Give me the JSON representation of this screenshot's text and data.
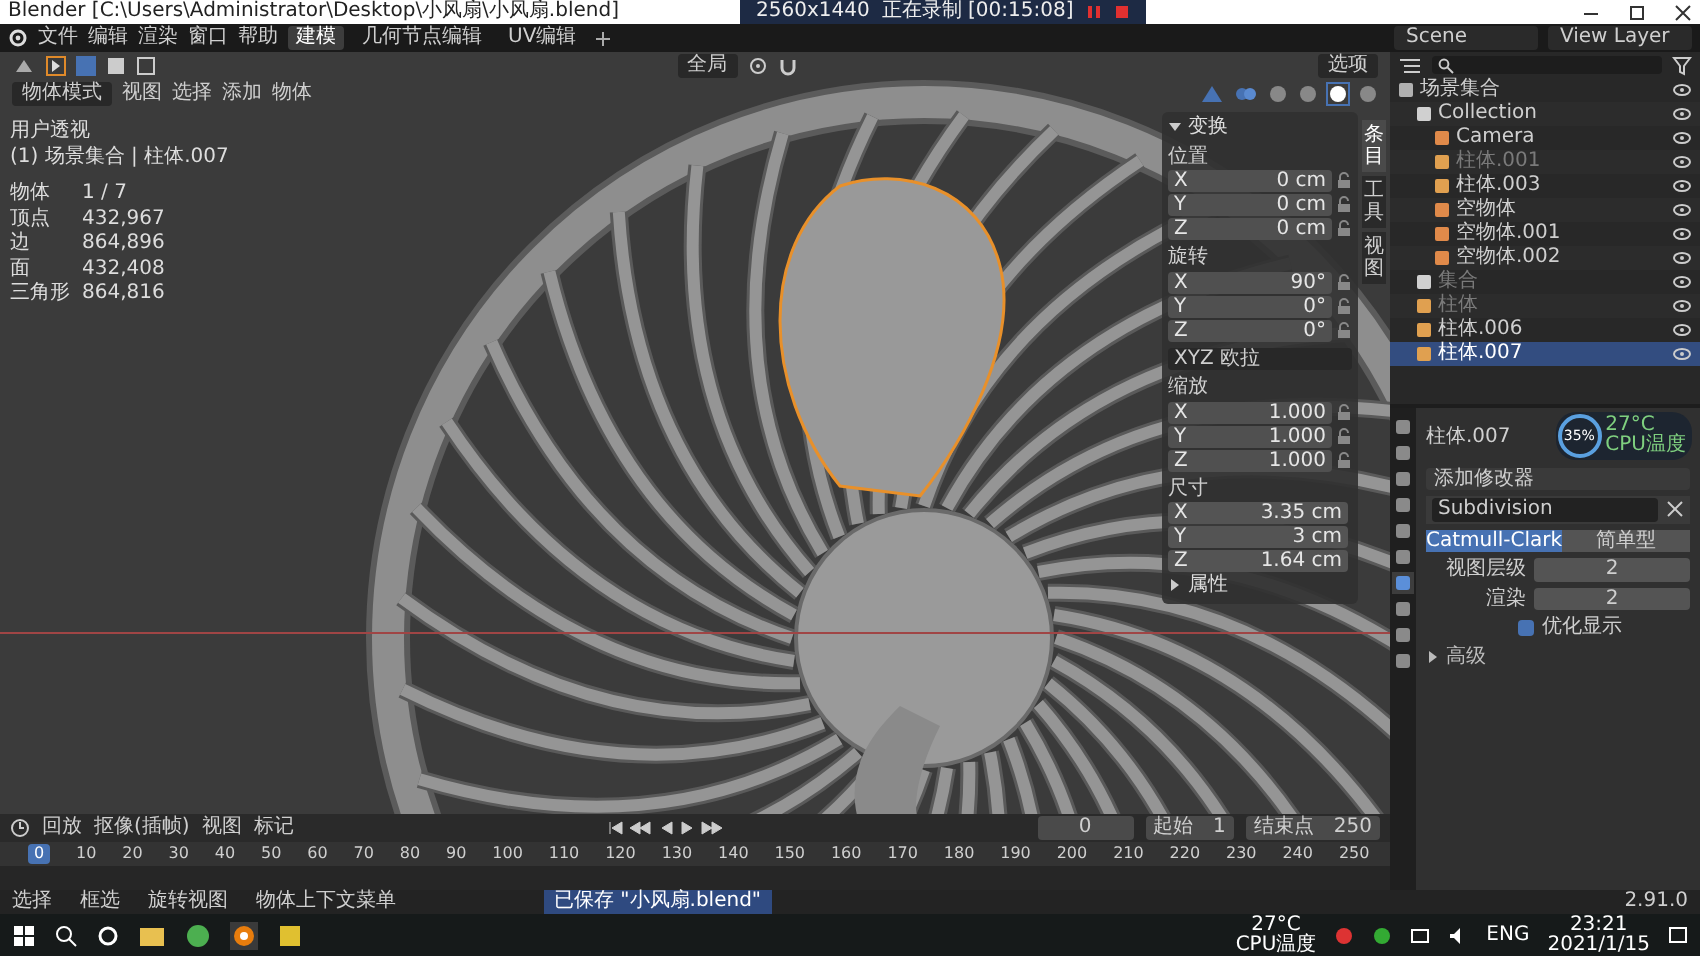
{
  "title_bar": {
    "title": "Blender [C:\\Users\\Administrator\\Desktop\\小风扇\\小风扇.blend]",
    "resolution": "2560x1440",
    "recording": "正在录制 [00:15:08]"
  },
  "menu": [
    "文件",
    "编辑",
    "渲染",
    "窗口",
    "帮助"
  ],
  "workspaces": [
    {
      "label": "建模",
      "selected": true
    },
    {
      "label": "几何节点编辑",
      "selected": false
    },
    {
      "label": "UV编辑",
      "selected": false
    }
  ],
  "scene": "Scene",
  "view_layer": "View Layer",
  "viewport": {
    "orientation": "全局",
    "options": "选项",
    "mode": "物体模式",
    "menus": [
      "视图",
      "选择",
      "添加",
      "物体"
    ],
    "shading": [
      {
        "selected": false
      },
      {
        "selected": false
      },
      {
        "selected": true
      },
      {
        "selected": false
      }
    ],
    "view_name": "用户透视",
    "context": "(1) 场景集合 | 柱体.007",
    "stats": [
      {
        "label": "物体",
        "value": "1 / 7"
      },
      {
        "label": "顶点",
        "value": "432,967"
      },
      {
        "label": "边",
        "value": "864,896"
      },
      {
        "label": "面",
        "value": "432,408"
      },
      {
        "label": "三角形",
        "value": "864,816"
      }
    ]
  },
  "n_panel": {
    "title": "变换",
    "tabs": [
      {
        "label": "条目",
        "selected": true
      },
      {
        "label": "工具",
        "selected": false
      },
      {
        "label": "视图",
        "selected": false
      }
    ],
    "groups": [
      {
        "kind": "fields",
        "label": "位置",
        "lockable": true,
        "fields": [
          {
            "axis": "X",
            "value": "0 cm"
          },
          {
            "axis": "Y",
            "value": "0 cm"
          },
          {
            "axis": "Z",
            "value": "0 cm"
          }
        ]
      },
      {
        "kind": "fields",
        "label": "旋转",
        "lockable": true,
        "fields": [
          {
            "axis": "X",
            "value": "90°"
          },
          {
            "axis": "Y",
            "value": "0°"
          },
          {
            "axis": "Z",
            "value": "0°"
          }
        ]
      },
      {
        "kind": "dropdown",
        "label": "XYZ 欧拉"
      },
      {
        "kind": "fields",
        "label": "缩放",
        "lockable": true,
        "fields": [
          {
            "axis": "X",
            "value": "1.000"
          },
          {
            "axis": "Y",
            "value": "1.000"
          },
          {
            "axis": "Z",
            "value": "1.000"
          }
        ]
      },
      {
        "kind": "fields",
        "label": "尺寸",
        "lockable": false,
        "fields": [
          {
            "axis": "X",
            "value": "3.35 cm"
          },
          {
            "axis": "Y",
            "value": "3 cm"
          },
          {
            "axis": "Z",
            "value": "1.64 cm"
          }
        ]
      }
    ],
    "properties_section": "属性"
  },
  "outliner": {
    "items": [
      {
        "name": "场景集合",
        "kind": "scene",
        "selected": false,
        "greyed": false,
        "children": [
          {
            "name": "Collection",
            "kind": "collection",
            "selected": false,
            "greyed": false,
            "children": [
              {
                "name": "Camera",
                "kind": "camera",
                "selected": false,
                "greyed": false
              },
              {
                "name": "柱体.001",
                "kind": "mesh",
                "selected": false,
                "greyed": true
              },
              {
                "name": "柱体.003",
                "kind": "mesh",
                "selected": false,
                "greyed": false
              },
              {
                "name": "空物体",
                "kind": "empty",
                "selected": false,
                "greyed": false
              },
              {
                "name": "空物体.001",
                "kind": "empty",
                "selected": false,
                "greyed": false
              },
              {
                "name": "空物体.002",
                "kind": "empty",
                "selected": false,
                "greyed": false
              }
            ]
          },
          {
            "name": "集合",
            "kind": "collection",
            "selected": false,
            "greyed": true
          },
          {
            "name": "柱体",
            "kind": "mesh",
            "selected": false,
            "greyed": true
          },
          {
            "name": "柱体.006",
            "kind": "mesh",
            "selected": false,
            "greyed": false
          },
          {
            "name": "柱体.007",
            "kind": "mesh",
            "selected": true,
            "greyed": false
          }
        ]
      }
    ]
  },
  "properties": {
    "tabs": [
      {
        "selected": false
      },
      {
        "selected": false
      },
      {
        "selected": false
      },
      {
        "selected": false
      },
      {
        "selected": false
      },
      {
        "selected": false
      },
      {
        "selected": true
      },
      {
        "selected": false
      },
      {
        "selected": false
      },
      {
        "selected": false
      }
    ],
    "object": "柱体.007",
    "add_modifier": "添加修改器",
    "modifier": "Subdivision",
    "modes": [
      {
        "label": "Catmull-Clark",
        "selected": true
      },
      {
        "label": "简单型",
        "selected": false
      }
    ],
    "rows": [
      {
        "label": "视图层级",
        "value": "2"
      },
      {
        "label": "渲染",
        "value": "2"
      }
    ],
    "optimal_display": {
      "label": "优化显示",
      "checked": true
    },
    "advanced": "高级",
    "cpu": {
      "percent": "35%",
      "temp": "27°C",
      "label": "CPU温度"
    }
  },
  "timeline": {
    "menus": [
      "回放",
      "抠像(插帧)",
      "视图",
      "标记"
    ],
    "current": "0",
    "start_label": "起始",
    "start": "1",
    "end_label": "结束点",
    "end": "250",
    "ticks": [
      "0",
      "10",
      "20",
      "30",
      "40",
      "50",
      "60",
      "70",
      "80",
      "90",
      "100",
      "110",
      "120",
      "130",
      "140",
      "150",
      "160",
      "170",
      "180",
      "190",
      "200",
      "210",
      "220",
      "230",
      "240",
      "250"
    ]
  },
  "status_bar": {
    "hints": [
      "选择",
      "框选",
      "旋转视图",
      "物体上下文菜单"
    ],
    "notice": "已保存 \"小风扇.blend\"",
    "version": "2.91.0"
  },
  "taskbar": {
    "temp": "27°C",
    "temp_label": "CPU温度",
    "lang": "ENG",
    "time": "23:21",
    "date": "2021/1/15"
  }
}
